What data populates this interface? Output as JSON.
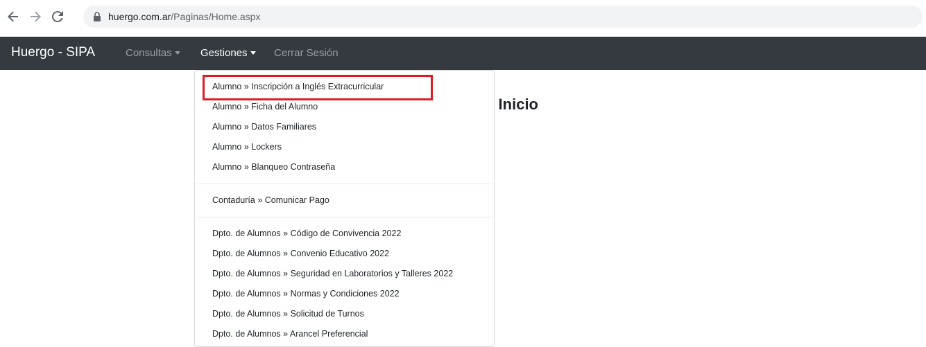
{
  "browser": {
    "url_domain": "huergo.com.ar",
    "url_path": "/Paginas/Home.aspx"
  },
  "navbar": {
    "brand": "Huergo - SIPA",
    "links": [
      {
        "label": "Consultas",
        "has_caret": true,
        "active": false
      },
      {
        "label": "Gestiones",
        "has_caret": true,
        "active": true
      },
      {
        "label": "Cerrar Sesión",
        "has_caret": false,
        "active": false
      }
    ]
  },
  "main": {
    "title": "Inicio"
  },
  "dropdown": {
    "groups": [
      {
        "items": [
          "Alumno » Inscripción a Inglés Extracurricular",
          "Alumno » Ficha del Alumno",
          "Alumno » Datos Familiares",
          "Alumno » Lockers",
          "Alumno » Blanqueo Contraseña"
        ]
      },
      {
        "items": [
          "Contaduría » Comunicar Pago"
        ]
      },
      {
        "items": [
          "Dpto. de Alumnos » Código de Convivencia 2022",
          "Dpto. de Alumnos » Convenio Educativo 2022",
          "Dpto. de Alumnos » Seguridad en Laboratorios y Talleres 2022",
          "Dpto. de Alumnos » Normas y Condiciones 2022",
          "Dpto. de Alumnos » Solicitud de Turnos",
          "Dpto. de Alumnos » Arancel Preferencial"
        ]
      }
    ]
  },
  "colors": {
    "navbar_bg": "#343a40",
    "highlight": "#e21b22"
  }
}
